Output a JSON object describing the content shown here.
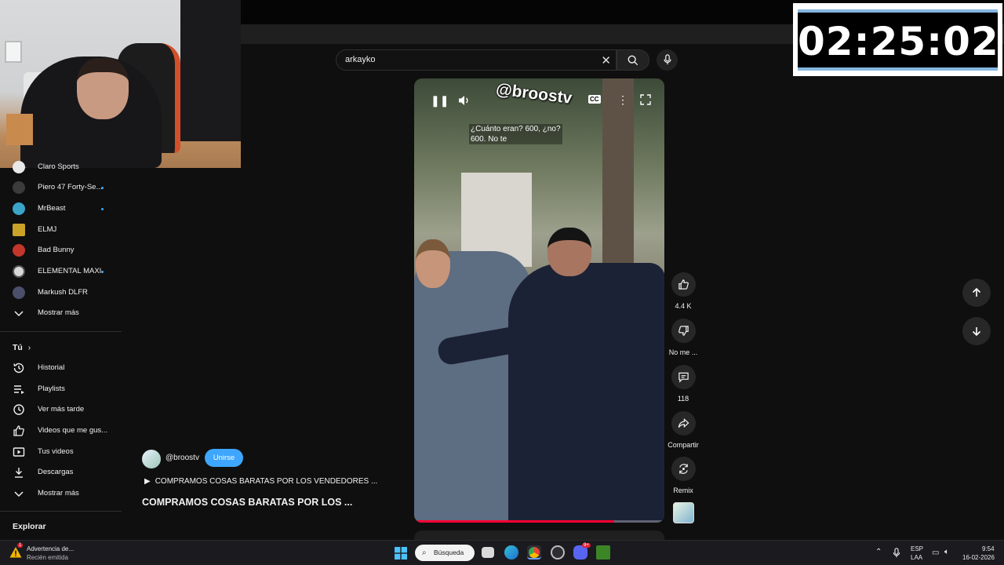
{
  "timer": {
    "value": "02:25:02"
  },
  "search": {
    "query": "arkayko",
    "clear_icon": "close-icon",
    "button_icon": "search-icon",
    "mic_icon": "mic-icon"
  },
  "sidebar": {
    "subscriptions": [
      {
        "label": "Claro Sports",
        "avatar_color": "#e8e8e8",
        "dot": false
      },
      {
        "label": "Piero 47 Forty-Se...",
        "avatar_color": "#3b3b3b",
        "dot": true
      },
      {
        "label": "MrBeast",
        "avatar_color": "#3aa5c9",
        "dot": true
      },
      {
        "label": "ELMJ",
        "avatar_color": "#c9a227",
        "dot": false
      },
      {
        "label": "Bad Bunny",
        "avatar_color": "#c2362b",
        "dot": false
      },
      {
        "label": "ELEMENTAL MAXI",
        "avatar_color": "#d8d8d8",
        "dot": true
      },
      {
        "label": "Markush DLFR",
        "avatar_color": "#4a4f6b",
        "dot": false
      }
    ],
    "show_more_1": "Mostrar más",
    "you_heading": "Tú",
    "you_items": [
      {
        "label": "Historial",
        "icon": "history-icon"
      },
      {
        "label": "Playlists",
        "icon": "playlist-icon"
      },
      {
        "label": "Ver más tarde",
        "icon": "watch-later-icon"
      },
      {
        "label": "Videos que me gus...",
        "icon": "liked-videos-icon"
      },
      {
        "label": "Tus videos",
        "icon": "your-videos-icon"
      },
      {
        "label": "Descargas",
        "icon": "downloads-icon"
      }
    ],
    "show_more_2": "Mostrar más",
    "explore_heading": "Explorar"
  },
  "short": {
    "watermark": "@broostv",
    "caption_line1": "¿Cuánto eran? 600, ¿no?",
    "caption_line2": "600. No te",
    "cc_label": "CC",
    "progress": 0.8
  },
  "actions": {
    "like_count": "4.4 K",
    "dislike_label": "No me ...",
    "comments_count": "118",
    "share_label": "Compartir",
    "remix_label": "Remix"
  },
  "channel": {
    "handle": "@broostv",
    "join_label": "Unirse",
    "playlist_text": "COMPRAMOS COSAS BARATAS POR LOS VENDEDORES ...",
    "title": "COMPRAMOS COSAS BARATAS POR LOS ..."
  },
  "taskbar": {
    "notif_title": "Advertencia de...",
    "notif_sub": "Recién emitida",
    "notif_badge": "1",
    "search_label": "Búsqueda",
    "lang_top": "ESP",
    "lang_bottom": "LAA",
    "time": "9:54",
    "date": "16-02-2026",
    "discord_badge": "9+"
  }
}
